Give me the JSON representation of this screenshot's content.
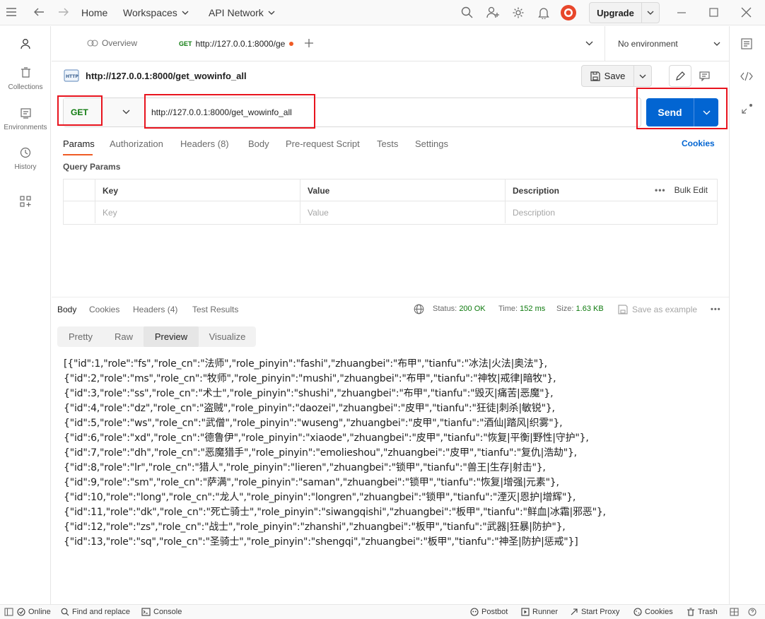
{
  "topbar": {
    "home": "Home",
    "workspaces": "Workspaces",
    "api_network": "API Network",
    "upgrade": "Upgrade"
  },
  "sidebar": {
    "items": [
      {
        "label": "Collections",
        "icon": "trash-can-icon"
      },
      {
        "label": "Environments",
        "icon": "environment-icon"
      },
      {
        "label": "History",
        "icon": "history-icon"
      }
    ]
  },
  "tabs": {
    "overview": "Overview",
    "active_method": "GET",
    "active_label": "http://127.0.0.1:8000/ge",
    "environment": "No environment"
  },
  "request": {
    "title": "http://127.0.0.1:8000/get_wowinfo_all",
    "save": "Save",
    "method": "GET",
    "url": "http://127.0.0.1:8000/get_wowinfo_all",
    "send": "Send",
    "tabs": [
      "Params",
      "Authorization",
      "Headers (8)",
      "Body",
      "Pre-request Script",
      "Tests",
      "Settings"
    ],
    "cookies": "Cookies",
    "query_params_title": "Query Params",
    "table": {
      "headers": [
        "Key",
        "Value",
        "Description"
      ],
      "bulk_edit": "Bulk Edit",
      "placeholders": [
        "Key",
        "Value",
        "Description"
      ]
    }
  },
  "response": {
    "tabs": [
      "Body",
      "Cookies",
      "Headers (4)",
      "Test Results"
    ],
    "status_label": "Status:",
    "status_value": "200 OK",
    "time_label": "Time:",
    "time_value": "152 ms",
    "size_label": "Size:",
    "size_value": "1.63 KB",
    "save_example": "Save as example",
    "views": [
      "Pretty",
      "Raw",
      "Preview",
      "Visualize"
    ],
    "body_lines": [
      "[{\"id\":1,\"role\":\"fs\",\"role_cn\":\"法师\",\"role_pinyin\":\"fashi\",\"zhuangbei\":\"布甲\",\"tianfu\":\"冰法|火法|奥法\"},",
      "{\"id\":2,\"role\":\"ms\",\"role_cn\":\"牧师\",\"role_pinyin\":\"mushi\",\"zhuangbei\":\"布甲\",\"tianfu\":\"神牧|戒律|暗牧\"},",
      "{\"id\":3,\"role\":\"ss\",\"role_cn\":\"术士\",\"role_pinyin\":\"shushi\",\"zhuangbei\":\"布甲\",\"tianfu\":\"毁灭|痛苦|恶魔\"},",
      "{\"id\":4,\"role\":\"dz\",\"role_cn\":\"盗贼\",\"role_pinyin\":\"daozei\",\"zhuangbei\":\"皮甲\",\"tianfu\":\"狂徒|刺杀|敏锐\"},",
      "{\"id\":5,\"role\":\"ws\",\"role_cn\":\"武僧\",\"role_pinyin\":\"wuseng\",\"zhuangbei\":\"皮甲\",\"tianfu\":\"酒仙|踏风|织雾\"},",
      "{\"id\":6,\"role\":\"xd\",\"role_cn\":\"德鲁伊\",\"role_pinyin\":\"xiaode\",\"zhuangbei\":\"皮甲\",\"tianfu\":\"恢复|平衡|野性|守护\"},",
      "{\"id\":7,\"role\":\"dh\",\"role_cn\":\"恶魔猎手\",\"role_pinyin\":\"emolieshou\",\"zhuangbei\":\"皮甲\",\"tianfu\":\"复仇|浩劫\"},",
      "{\"id\":8,\"role\":\"lr\",\"role_cn\":\"猎人\",\"role_pinyin\":\"lieren\",\"zhuangbei\":\"锁甲\",\"tianfu\":\"兽王|生存|射击\"},",
      "{\"id\":9,\"role\":\"sm\",\"role_cn\":\"萨满\",\"role_pinyin\":\"saman\",\"zhuangbei\":\"锁甲\",\"tianfu\":\"恢复|增强|元素\"},",
      "{\"id\":10,\"role\":\"long\",\"role_cn\":\"龙人\",\"role_pinyin\":\"longren\",\"zhuangbei\":\"锁甲\",\"tianfu\":\"湮灭|恩护|增辉\"},",
      "{\"id\":11,\"role\":\"dk\",\"role_cn\":\"死亡骑士\",\"role_pinyin\":\"siwangqishi\",\"zhuangbei\":\"板甲\",\"tianfu\":\"鲜血|冰霜|邪恶\"},",
      "{\"id\":12,\"role\":\"zs\",\"role_cn\":\"战士\",\"role_pinyin\":\"zhanshi\",\"zhuangbei\":\"板甲\",\"tianfu\":\"武器|狂暴|防护\"},",
      "{\"id\":13,\"role\":\"sq\",\"role_cn\":\"圣骑士\",\"role_pinyin\":\"shengqi\",\"zhuangbei\":\"板甲\",\"tianfu\":\"神圣|防护|惩戒\"}]"
    ]
  },
  "statusbar": {
    "online": "Online",
    "find_replace": "Find and replace",
    "console": "Console",
    "postbot": "Postbot",
    "runner": "Runner",
    "start_proxy": "Start Proxy",
    "cookies": "Cookies",
    "trash": "Trash"
  },
  "colors": {
    "send_blue": "#0265d2",
    "get_green": "#0f7b0f",
    "highlight_red": "#e8141e",
    "active_tab_orange": "#ef5b25"
  }
}
